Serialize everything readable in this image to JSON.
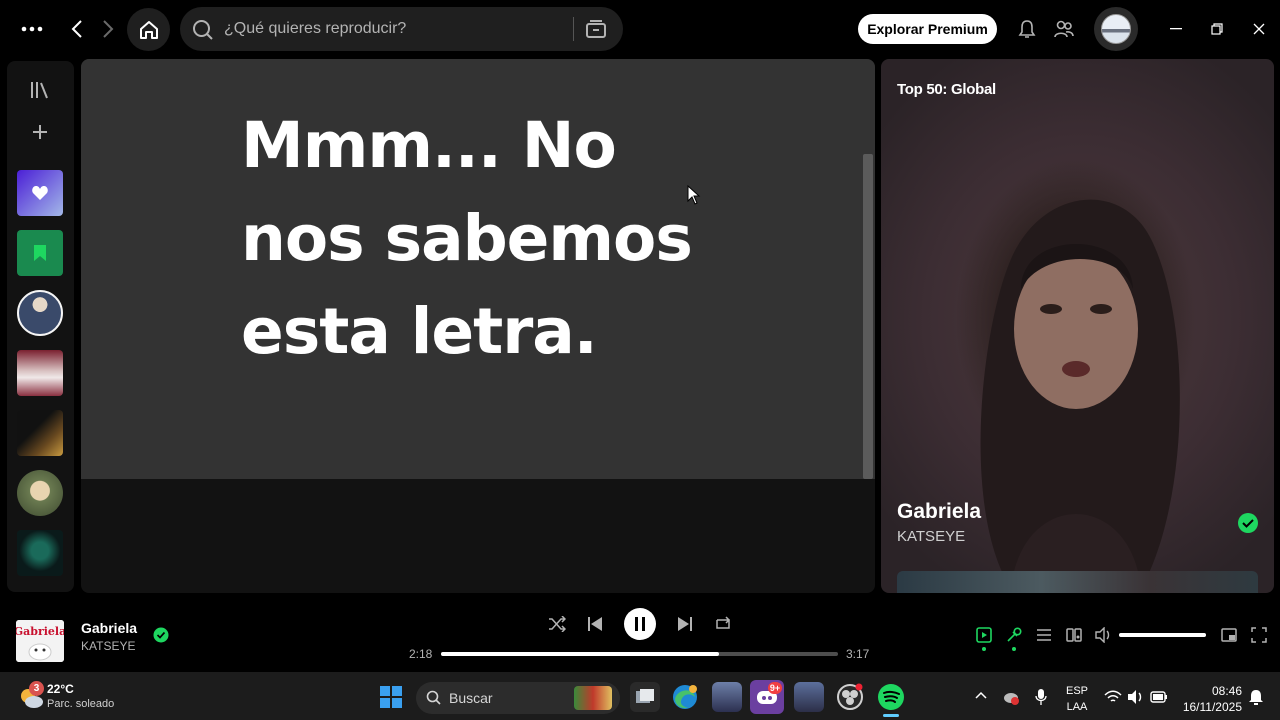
{
  "search": {
    "placeholder": "¿Qué quieres reproducir?"
  },
  "header": {
    "premium_label": "Explorar Premium"
  },
  "lyrics": {
    "message": "Mmm... No nos sabemos esta letra."
  },
  "now_playing_panel": {
    "playlist": "Top 50: Global",
    "song": "Gabriela",
    "artist": "KATSEYE"
  },
  "player": {
    "song": "Gabriela",
    "artist": "KATSEYE",
    "elapsed": "2:18",
    "duration": "3:17",
    "progress_fraction": 0.7,
    "volume_fraction": 1.0
  },
  "taskbar": {
    "weather_temp": "22°C",
    "weather_desc": "Parc. soleado",
    "weather_badge": "3",
    "search_label": "Buscar",
    "discord_badge": "9+",
    "lang_top": "ESP",
    "lang_bottom": "LAA",
    "time": "08:46",
    "date": "16/11/2025"
  },
  "colors": {
    "accent_green": "#1ed760",
    "lyrics_bg": "#333333",
    "app_bg": "#121212"
  }
}
